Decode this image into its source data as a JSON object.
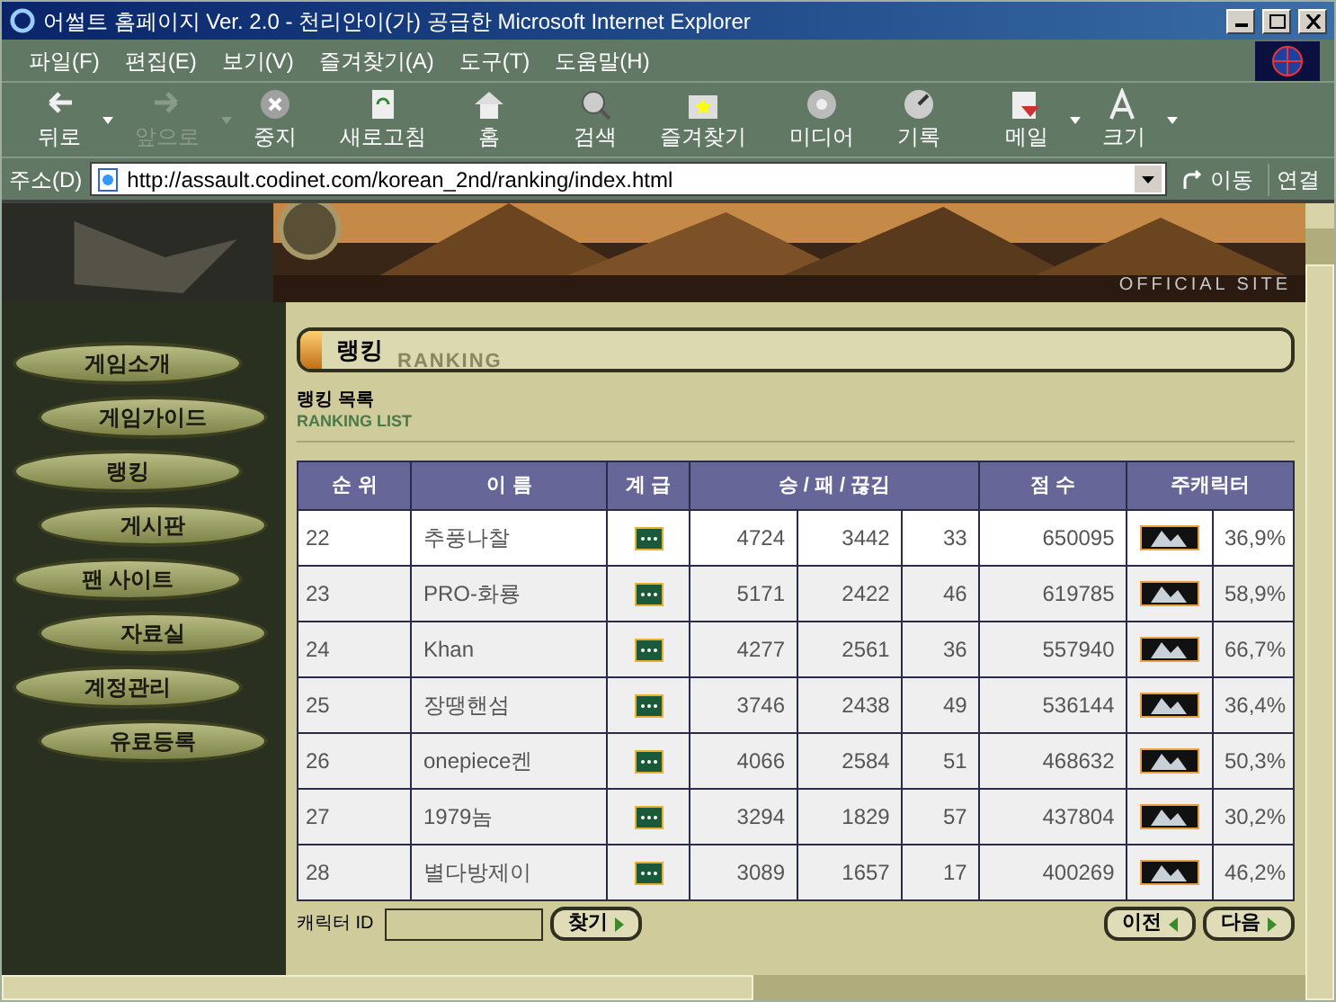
{
  "window": {
    "title": "어썰트 홈페이지 Ver. 2.0 - 천리안이(가) 공급한 Microsoft Internet Explorer"
  },
  "menu": [
    "파일(F)",
    "편집(E)",
    "보기(V)",
    "즐겨찾기(A)",
    "도구(T)",
    "도움말(H)"
  ],
  "toolbar": [
    {
      "label": "뒤로",
      "kind": "back",
      "disabled": false,
      "dropdown": true
    },
    {
      "label": "앞으로",
      "kind": "forward",
      "disabled": true,
      "dropdown": true
    },
    {
      "label": "중지",
      "kind": "stop",
      "disabled": false,
      "dropdown": false
    },
    {
      "label": "새로고침",
      "kind": "refresh",
      "disabled": false,
      "dropdown": false
    },
    {
      "label": "홈",
      "kind": "home",
      "disabled": false,
      "dropdown": false
    },
    {
      "label": "검색",
      "kind": "search",
      "disabled": false,
      "dropdown": false
    },
    {
      "label": "즐겨찾기",
      "kind": "favorites",
      "disabled": false,
      "dropdown": false
    },
    {
      "label": "미디어",
      "kind": "media",
      "disabled": false,
      "dropdown": false
    },
    {
      "label": "기록",
      "kind": "history",
      "disabled": false,
      "dropdown": false
    },
    {
      "label": "메일",
      "kind": "mail",
      "disabled": false,
      "dropdown": true
    },
    {
      "label": "크기",
      "kind": "font",
      "disabled": false,
      "dropdown": true
    }
  ],
  "address": {
    "label": "주소(D)",
    "value": "http://assault.codinet.com/korean_2nd/ranking/index.html",
    "go": "이동",
    "links": "연결"
  },
  "banner": {
    "tagline": "OFFICIAL SITE"
  },
  "nav": [
    "게임소개",
    "게임가이드",
    "랭킹",
    "게시판",
    "팬 사이트",
    "자료실",
    "계정관리",
    "유료등록"
  ],
  "page": {
    "title": "랭킹",
    "title_shadow": "RANKING",
    "subtitle": "랭킹 목록",
    "subtitle_en": "RANKING LIST"
  },
  "table": {
    "columns": [
      "순 위",
      "이 름",
      "계 급",
      "승 / 패 / 끊김",
      "점 수",
      "주캐릭터"
    ],
    "rows": [
      {
        "rank": "22",
        "name": "추풍나찰",
        "wins": "4724",
        "losses": "3442",
        "disconnects": "33",
        "score": "650095",
        "ratio": "36,9%",
        "highlighted": true
      },
      {
        "rank": "23",
        "name": "PRO-화룡",
        "wins": "5171",
        "losses": "2422",
        "disconnects": "46",
        "score": "619785",
        "ratio": "58,9%",
        "highlighted": false
      },
      {
        "rank": "24",
        "name": "Khan",
        "wins": "4277",
        "losses": "2561",
        "disconnects": "36",
        "score": "557940",
        "ratio": "66,7%",
        "highlighted": false
      },
      {
        "rank": "25",
        "name": "장땡핸섬",
        "wins": "3746",
        "losses": "2438",
        "disconnects": "49",
        "score": "536144",
        "ratio": "36,4%",
        "highlighted": false
      },
      {
        "rank": "26",
        "name": "onepiece켄",
        "wins": "4066",
        "losses": "2584",
        "disconnects": "51",
        "score": "468632",
        "ratio": "50,3%",
        "highlighted": false
      },
      {
        "rank": "27",
        "name": "1979놈",
        "wins": "3294",
        "losses": "1829",
        "disconnects": "57",
        "score": "437804",
        "ratio": "30,2%",
        "highlighted": false
      },
      {
        "rank": "28",
        "name": "별다방제이",
        "wins": "3089",
        "losses": "1657",
        "disconnects": "17",
        "score": "400269",
        "ratio": "46,2%",
        "highlighted": false
      }
    ]
  },
  "search": {
    "label": "캐릭터 ID",
    "button": "찾기"
  },
  "pager": {
    "prev": "이전",
    "next": "다음"
  }
}
